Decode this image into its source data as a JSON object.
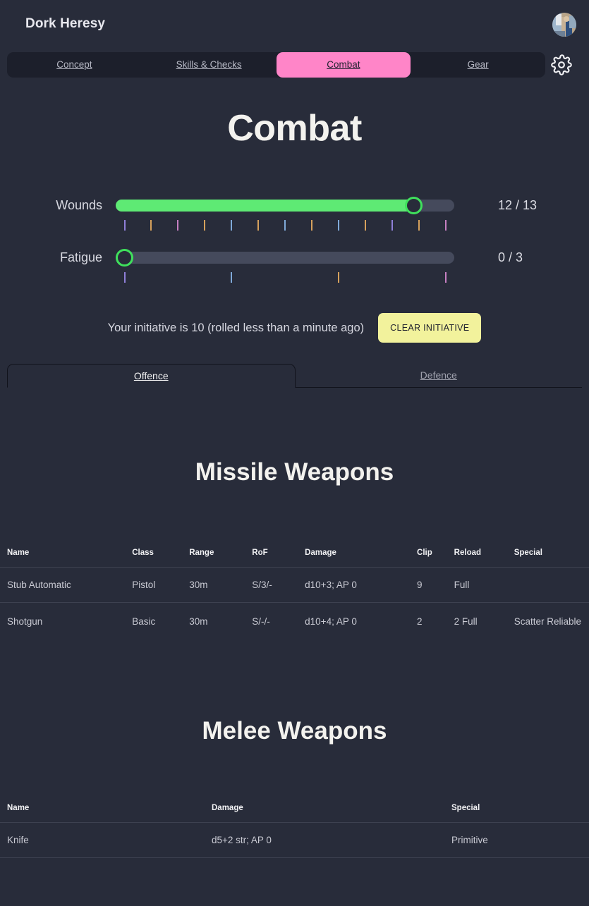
{
  "header": {
    "app_title": "Dork Heresy",
    "avatar_name": "user-avatar",
    "settings_icon": "gear-icon"
  },
  "nav": {
    "items": [
      {
        "label": "Concept",
        "active": false
      },
      {
        "label": "Skills & Checks",
        "active": false
      },
      {
        "label": "Combat",
        "active": true
      },
      {
        "label": "Gear",
        "active": false
      }
    ],
    "active_color": "#ff85c8"
  },
  "page": {
    "title": "Combat"
  },
  "stats": {
    "wounds": {
      "label": "Wounds",
      "value": 12,
      "max": 13,
      "value_text": "12 / 13",
      "fill_percent": 90,
      "tick_count": 13,
      "tick_colors": [
        "#8f7fd8",
        "#d6a15c",
        "#c77fc2",
        "#d6a15c",
        "#7fa9d8",
        "#d6a15c",
        "#7fa9d8",
        "#d6a15c",
        "#7fa9d8",
        "#d6a15c",
        "#8f7fd8",
        "#d6a15c",
        "#c77fc2"
      ]
    },
    "fatigue": {
      "label": "Fatigue",
      "value": 0,
      "max": 3,
      "value_text": "0 / 3",
      "fill_percent": 0,
      "tick_count": 4,
      "tick_colors": [
        "#8f7fd8",
        "#7fa9d8",
        "#d6a15c",
        "#c77fc2"
      ]
    }
  },
  "initiative": {
    "text": "Your initiative is 10 (rolled less than a minute ago)",
    "clear_button": "CLEAR INITIATIVE",
    "button_color": "#f2f29c"
  },
  "subtabs": [
    {
      "label": "Offence",
      "active": true
    },
    {
      "label": "Defence",
      "active": false
    }
  ],
  "missile": {
    "title": "Missile Weapons",
    "columns": [
      "Name",
      "Class",
      "Range",
      "RoF",
      "Damage",
      "Clip",
      "Reload",
      "Special"
    ],
    "rows": [
      {
        "name": "Stub Automatic",
        "class": "Pistol",
        "range": "30m",
        "rof": "S/3/-",
        "damage": "d10+3; AP 0",
        "clip": "9",
        "reload": "Full",
        "special": ""
      },
      {
        "name": "Shotgun",
        "class": "Basic",
        "range": "30m",
        "rof": "S/-/-",
        "damage": "d10+4; AP 0",
        "clip": "2",
        "reload": "2 Full",
        "special": "Scatter Reliable"
      }
    ]
  },
  "melee": {
    "title": "Melee Weapons",
    "columns": [
      "Name",
      "Damage",
      "Special"
    ],
    "rows": [
      {
        "name": "Knife",
        "damage": "d5+2 str; AP 0",
        "special": "Primitive"
      }
    ]
  }
}
